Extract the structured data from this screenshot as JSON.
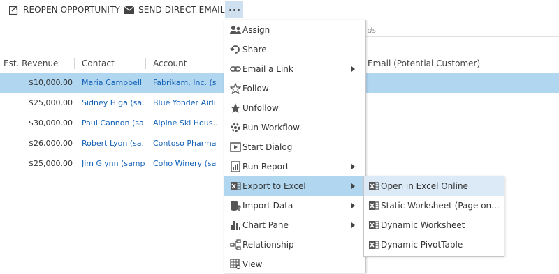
{
  "toolbar": {
    "reopen_label": "REOPEN OPPORTUNITY",
    "send_email_label": "SEND DIRECT EMAIL",
    "more_icon": "ellipsis-icon"
  },
  "search": {
    "placeholder_fragment": "rds"
  },
  "grid": {
    "columns": [
      "Est. Revenue",
      "Contact",
      "Account",
      "Email (Potential Customer)"
    ],
    "rows": [
      {
        "revenue": "$10,000.00",
        "contact": "Maria Campbell ...",
        "account": "Fabrikam, Inc. (s...",
        "selected": true
      },
      {
        "revenue": "$25,000.00",
        "contact": "Sidney Higa (sa...",
        "account": "Blue Yonder Airli..."
      },
      {
        "revenue": "$30,000.00",
        "contact": "Paul Cannon (sa...",
        "account": "Alpine Ski Hous..."
      },
      {
        "revenue": "$26,000.00",
        "contact": "Robert Lyon (sa...",
        "account": "Contoso Pharma..."
      },
      {
        "revenue": "$25,000.00",
        "contact": "Jim Glynn (samp...",
        "account": "Coho Winery (sa..."
      }
    ]
  },
  "menu": {
    "items": [
      {
        "label": "Assign",
        "icon": "assign-icon"
      },
      {
        "label": "Share",
        "icon": "share-icon"
      },
      {
        "label": "Email a Link",
        "icon": "link-icon",
        "submenu": true
      },
      {
        "label": "Follow",
        "icon": "star-outline-icon"
      },
      {
        "label": "Unfollow",
        "icon": "star-filled-icon"
      },
      {
        "label": "Run Workflow",
        "icon": "workflow-icon"
      },
      {
        "label": "Start Dialog",
        "icon": "dialog-icon"
      },
      {
        "label": "Run Report",
        "icon": "report-icon",
        "submenu": true
      },
      {
        "label": "Export to Excel",
        "icon": "excel-icon",
        "submenu": true,
        "active": true
      },
      {
        "label": "Import Data",
        "icon": "import-icon",
        "submenu": true
      },
      {
        "label": "Chart Pane",
        "icon": "chart-icon",
        "submenu": true
      },
      {
        "label": "Relationship",
        "icon": "relationship-icon"
      },
      {
        "label": "View",
        "icon": "view-icon"
      }
    ]
  },
  "submenu": {
    "items": [
      {
        "label": "Open in Excel Online",
        "icon": "excel-icon",
        "hover": true
      },
      {
        "label": "Static Worksheet (Page on...",
        "icon": "excel-icon"
      },
      {
        "label": "Dynamic Worksheet",
        "icon": "excel-icon"
      },
      {
        "label": "Dynamic PivotTable",
        "icon": "excel-icon"
      }
    ]
  },
  "colors": {
    "selection": "#b1d6f0",
    "hover": "#dbeaf6",
    "link": "#1160b7"
  }
}
